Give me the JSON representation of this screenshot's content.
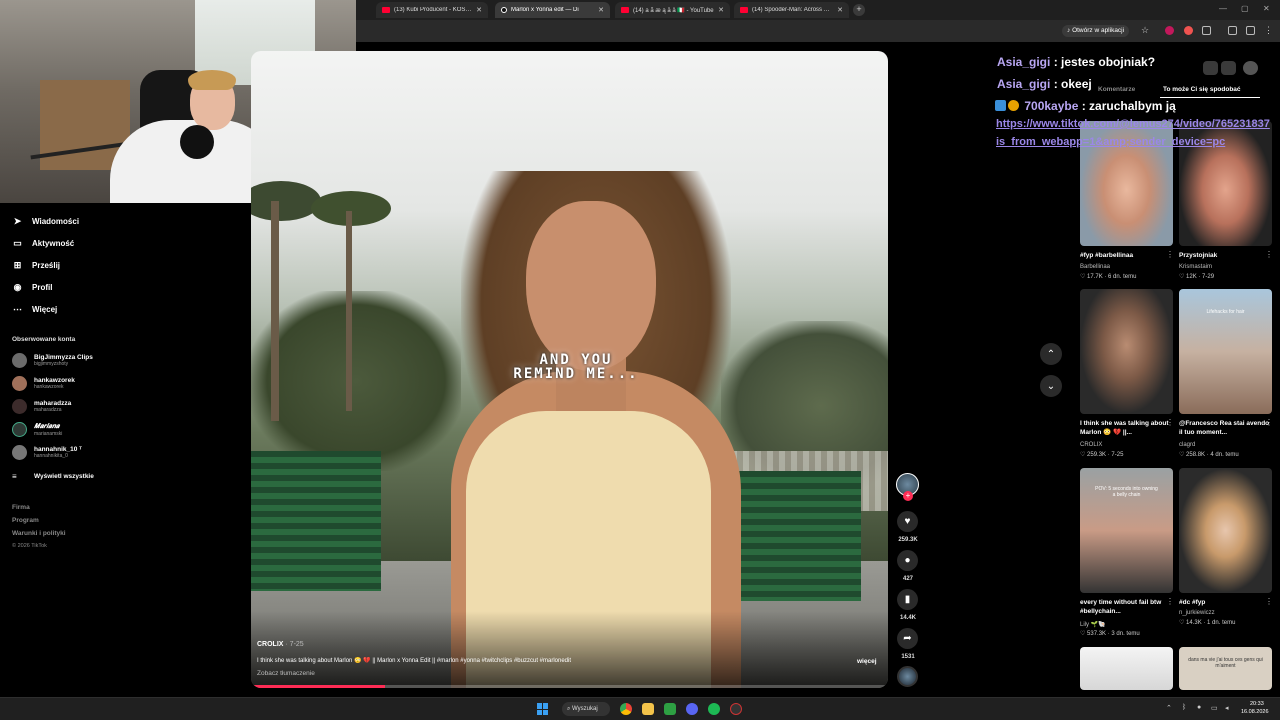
{
  "browser": {
    "tabs": [
      {
        "label": "(13) Kubi Producent - KOSZT B",
        "icon": "youtube-icon"
      },
      {
        "label": "Marlon x Yonna edit — Di",
        "icon": "tiktok-icon",
        "active": true
      },
      {
        "label": "(14) a ã æ ą ā ä 🇮🇹 - YouTube",
        "icon": "youtube-icon"
      },
      {
        "label": "(14) Spooder-Man: Across The",
        "icon": "youtube-icon"
      }
    ],
    "new_tab": "+",
    "close_symbol": "✕",
    "open_in_app": "Otwórz w aplikacji"
  },
  "sidebar": {
    "nav": [
      {
        "label": "Wiadomości",
        "icon": "send-icon"
      },
      {
        "label": "Aktywność",
        "icon": "activity-icon"
      },
      {
        "label": "Prześlij",
        "icon": "upload-icon"
      },
      {
        "label": "Profil",
        "icon": "profile-icon"
      },
      {
        "label": "Więcej",
        "icon": "more-icon"
      }
    ],
    "followed_title": "Obserwowane konta",
    "accounts": [
      {
        "name": "BigJimmyzza Clips",
        "handle": "bigjimmyzshoty"
      },
      {
        "name": "hankawzorek",
        "handle": "hankawzorek"
      },
      {
        "name": "maharadzza",
        "handle": "maharadzza"
      },
      {
        "name": "𝑴𝒂𝒓𝒊𝒂𝒏𝒂",
        "handle": "marianamski"
      },
      {
        "name": "hannahnik_10 ᵀ",
        "handle": "hannahnikita_0"
      }
    ],
    "show_all": "Wyświetl wszystkie",
    "footer": [
      "Firma",
      "Program",
      "Warunki i polityki"
    ],
    "copyright": "© 2026 TikTok"
  },
  "video": {
    "overlay_text_line1": "AND YOU",
    "overlay_text_line2": "REMIND ME...",
    "author": "CROLIX",
    "date": " · 7-25",
    "description": "I think she was talking about Marlon 😳 💔 || Marlon x Yonna Edit || #marlon #yonna #twitchclips #buzzcut #marlonedit",
    "translate": "Zobacz tłumaczenie",
    "more": "więcej",
    "progress": 0.21,
    "likes": "259.3K",
    "comments": "427",
    "saves": "14.4K",
    "shares": "1531"
  },
  "chat": [
    {
      "user": "Asia_gigi",
      "message": " : jestes obojniak?"
    },
    {
      "user": "Asia_gigi",
      "message": " : okeej"
    },
    {
      "user": "700kaybe",
      "message": " : zaruchalbym ją"
    }
  ],
  "chat_link_line1": "https://www.tiktok.com/@lemus274/video/765231837",
  "chat_link_line2": "is_from_webapp=1&amp;sender_device=pc",
  "right_panel": {
    "tabs": [
      "Komentarze",
      "To może Ci się spodobać"
    ],
    "cards": [
      {
        "title": "#fyp #barbellinaa",
        "author": "Barbellinaa",
        "meta": "♡ 17.7K  ·  6 dn. temu"
      },
      {
        "title": "Przystojniak",
        "author": "Krismastaim",
        "meta": "♡ 12K  ·  7-29"
      },
      {
        "title": "I think she was talking about Marlon 😳 💔 ||...",
        "author": "CROLIX",
        "meta": "♡ 259.3K  ·  7-25"
      },
      {
        "title": "@Francesco Rea stai avendo il tuo moment...",
        "author": "clagrd",
        "meta": "♡ 258.8K  ·  4 dn. temu",
        "caption": "Lifehacks for hair"
      },
      {
        "title": "every time without fail btw #bellychain...",
        "author": "Lily 🌱🐚",
        "meta": "♡ 537.3K  ·  3 dn. temu",
        "caption": "POV: 5 seconds into owning a belly chain"
      },
      {
        "title": "#dc #fyp",
        "author": "n_jurkiewiczz",
        "meta": "♡ 14.3K  ·  1 dn. temu"
      },
      {
        "caption": ""
      },
      {
        "caption": "dans ma vie j'ai tous ces gens qui m'aiment"
      }
    ]
  },
  "taskbar": {
    "search": "Wyszukaj",
    "time": "20:33",
    "date": "16.08.2026"
  },
  "colors": {
    "accent": "#fe2c55",
    "chat_user": "#b9a7f3",
    "chat_link": "#9b87e8"
  }
}
